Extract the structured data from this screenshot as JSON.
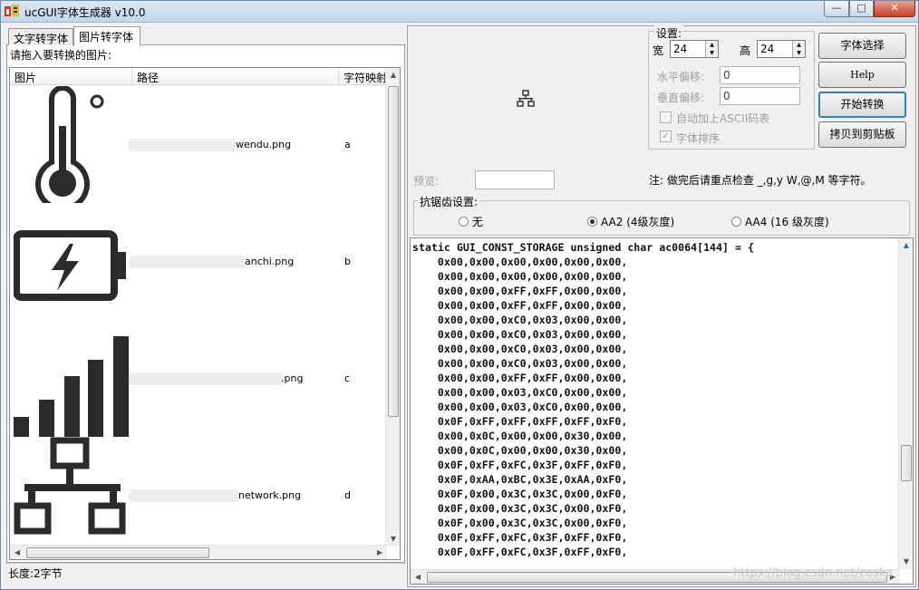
{
  "window": {
    "title": "ucGUI字体生成器 v10.0",
    "minimize_glyph": "—",
    "maximize_glyph": "□",
    "close_glyph": "✕"
  },
  "tabs": [
    {
      "label": "文字转字体",
      "active": false
    },
    {
      "label": "图片转字体",
      "active": true
    }
  ],
  "left": {
    "drop_label": "请拖入要转换的图片:",
    "columns": [
      "图片",
      "路径",
      "字符映射"
    ],
    "rows": [
      {
        "icon": "thermometer-icon",
        "path": "wendu.png",
        "map": "a"
      },
      {
        "icon": "battery-charging-icon",
        "path": "anchi.png",
        "map": "b"
      },
      {
        "icon": "signal-bars-icon",
        "path": ".png",
        "map": "c"
      },
      {
        "icon": "network-icon",
        "path": "network.png",
        "map": "d"
      }
    ],
    "status": "长度:2字节"
  },
  "settings": {
    "legend": "设置:",
    "width_label": "宽",
    "width_value": "24",
    "height_label": "高",
    "height_value": "24",
    "h_offset_label": "水平偏移:",
    "h_offset_value": "0",
    "v_offset_label": "垂直偏移:",
    "v_offset_value": "0",
    "ascii_label": "自动加上ASCII码表",
    "ascii_checked": false,
    "sort_label": "字体排序",
    "sort_checked": true
  },
  "buttons": {
    "font_select": "字体选择",
    "help": "Help",
    "start": "开始转换",
    "copy": "拷贝到剪贴板"
  },
  "preview": {
    "label": "预览:",
    "value": "",
    "note": "注: 做完后请重点检查 _,g,y W,@,M 等字符。"
  },
  "antialias": {
    "legend": "抗锯齿设置:",
    "options": [
      {
        "label": "无",
        "selected": false
      },
      {
        "label": "AA2 (4级灰度)",
        "selected": true
      },
      {
        "label": "AA4 (16 级灰度)",
        "selected": false
      }
    ]
  },
  "code_lines": [
    "static GUI_CONST_STORAGE unsigned char ac0064[144] = {",
    "    0x00,0x00,0x00,0x00,0x00,0x00,",
    "    0x00,0x00,0x00,0x00,0x00,0x00,",
    "    0x00,0x00,0xFF,0xFF,0x00,0x00,",
    "    0x00,0x00,0xFF,0xFF,0x00,0x00,",
    "    0x00,0x00,0xC0,0x03,0x00,0x00,",
    "    0x00,0x00,0xC0,0x03,0x00,0x00,",
    "    0x00,0x00,0xC0,0x03,0x00,0x00,",
    "    0x00,0x00,0xC0,0x03,0x00,0x00,",
    "    0x00,0x00,0xFF,0xFF,0x00,0x00,",
    "    0x00,0x00,0x03,0xC0,0x00,0x00,",
    "    0x00,0x00,0x03,0xC0,0x00,0x00,",
    "    0x0F,0xFF,0xFF,0xFF,0xFF,0xF0,",
    "    0x00,0x0C,0x00,0x00,0x30,0x00,",
    "    0x00,0x0C,0x00,0x00,0x30,0x00,",
    "    0x0F,0xFF,0xFC,0x3F,0xFF,0xF0,",
    "    0x0F,0xAA,0xBC,0x3E,0xAA,0xF0,",
    "    0x0F,0x00,0x3C,0x3C,0x00,0xF0,",
    "    0x0F,0x00,0x3C,0x3C,0x00,0xF0,",
    "    0x0F,0x00,0x3C,0x3C,0x00,0xF0,",
    "    0x0F,0xFF,0xFC,0x3F,0xFF,0xF0,",
    "    0x0F,0xFF,0xFC,0x3F,0xFF,0xF0,"
  ],
  "watermark": "https://blog.csdn.net/coska"
}
